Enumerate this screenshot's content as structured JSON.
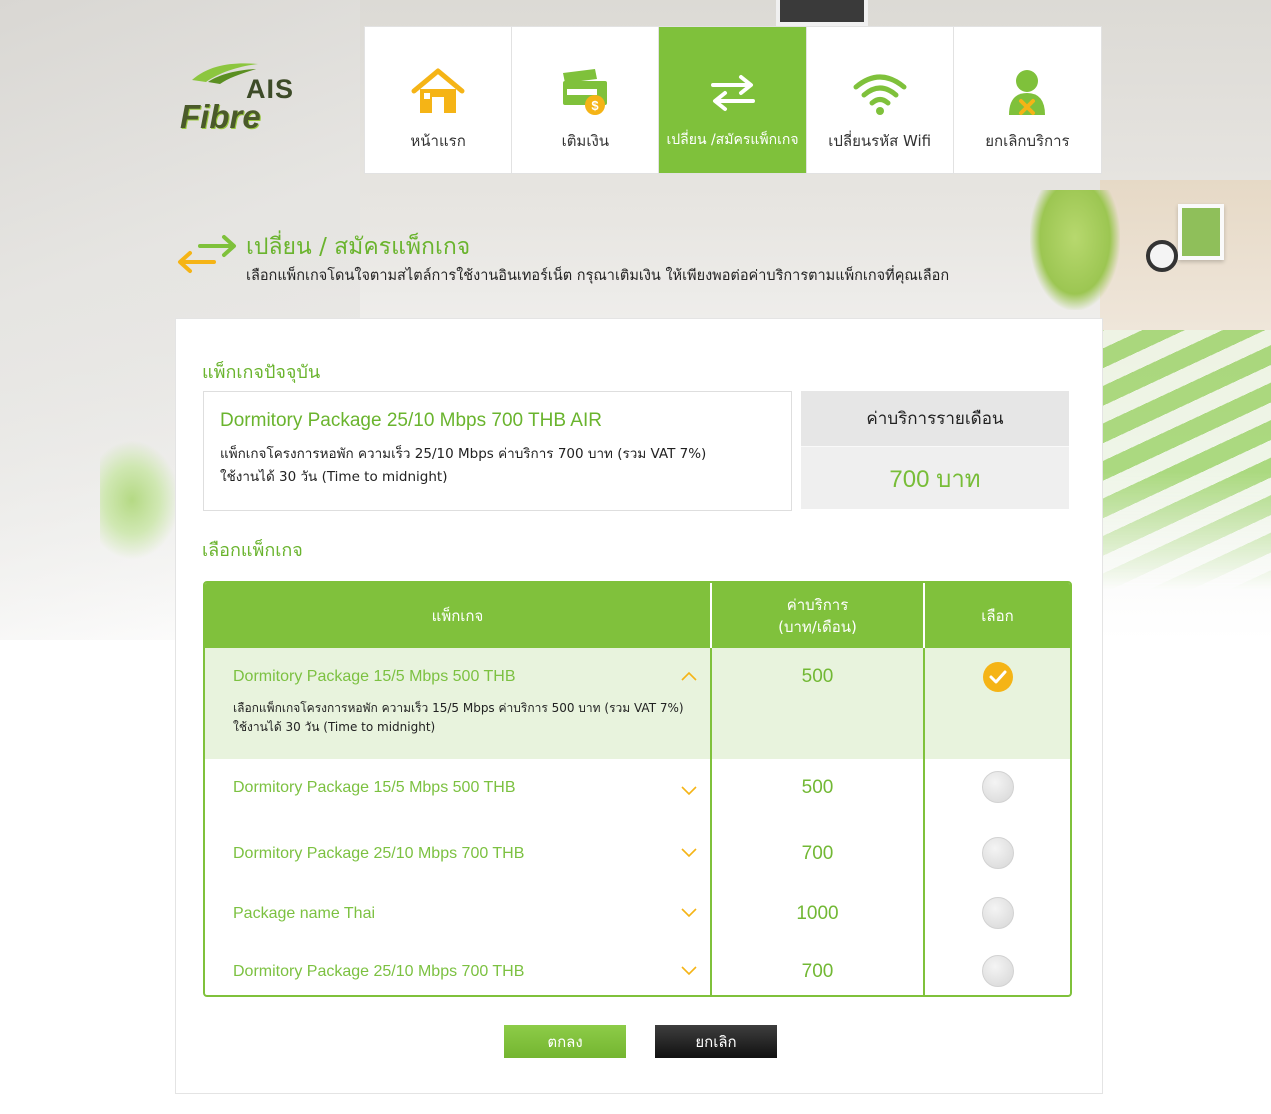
{
  "brand": {
    "line1": "AIS",
    "line2": "Fibre"
  },
  "nav": {
    "items": [
      {
        "label": "หน้าแรก",
        "icon": "home-icon",
        "active": false
      },
      {
        "label": "เติมเงิน",
        "icon": "topup-icon",
        "active": false
      },
      {
        "label": "เปลี่ยน /สมัครแพ็กเกจ",
        "icon": "swap-arrows-icon",
        "active": true
      },
      {
        "label": "เปลี่ยนรหัส Wifi",
        "icon": "wifi-icon",
        "active": false
      },
      {
        "label": "ยกเลิกบริการ",
        "icon": "cancel-user-icon",
        "active": false
      }
    ]
  },
  "page": {
    "title": "เปลี่ยน / สมัครแพ็กเกจ",
    "description": "เลือกแพ็กเกจโดนใจตามสไตล์การใช้งานอินเทอร์เน็ต กรุณาเติมเงิน ให้เพียงพอต่อค่าบริการตามแพ็กเกจที่คุณเลือก"
  },
  "current": {
    "section_title": "แพ็กเกจปัจจุบัน",
    "name": "Dormitory Package 25/10 Mbps 700 THB AIR",
    "desc_line1": "แพ็กเกจโครงการหอพัก ความเร็ว 25/10 Mbps ค่าบริการ 700 บาท (รวม VAT 7%)",
    "desc_line2": "ใช้งานได้ 30 วัน (Time to midnight)",
    "fee_label": "ค่าบริการรายเดือน",
    "fee_value": "700 บาท"
  },
  "select": {
    "section_title": "เลือกแพ็กเกจ",
    "headers": {
      "package": "แพ็กเกจ",
      "price_line1": "ค่าบริการ",
      "price_line2": "(บาท/เดือน)",
      "choose": "เลือก"
    },
    "rows": [
      {
        "name": "Dormitory Package 15/5 Mbps 500 THB",
        "price": "500",
        "expanded": true,
        "selected": true,
        "desc_line1": "เลือกแพ็กเกจโครงการหอพัก ความเร็ว 15/5 Mbps ค่าบริการ 500 บาท (รวม VAT 7%)",
        "desc_line2": "ใช้งานได้ 30 วัน (Time to midnight)"
      },
      {
        "name": "Dormitory Package 15/5 Mbps 500 THB",
        "price": "500",
        "expanded": false,
        "selected": false
      },
      {
        "name": "Dormitory Package 25/10 Mbps 700 THB",
        "price": "700",
        "expanded": false,
        "selected": false
      },
      {
        "name": "Package name Thai",
        "price": "1000",
        "expanded": false,
        "selected": false
      },
      {
        "name": "Dormitory Package 25/10 Mbps 700 THB",
        "price": "700",
        "expanded": false,
        "selected": false
      }
    ]
  },
  "buttons": {
    "ok": "ตกลง",
    "cancel": "ยกเลิก"
  },
  "colors": {
    "brand_green": "#7fc13b",
    "accent_orange": "#f5b416",
    "text_green": "#6ab42e",
    "dark_button": "#1a1a1a"
  }
}
